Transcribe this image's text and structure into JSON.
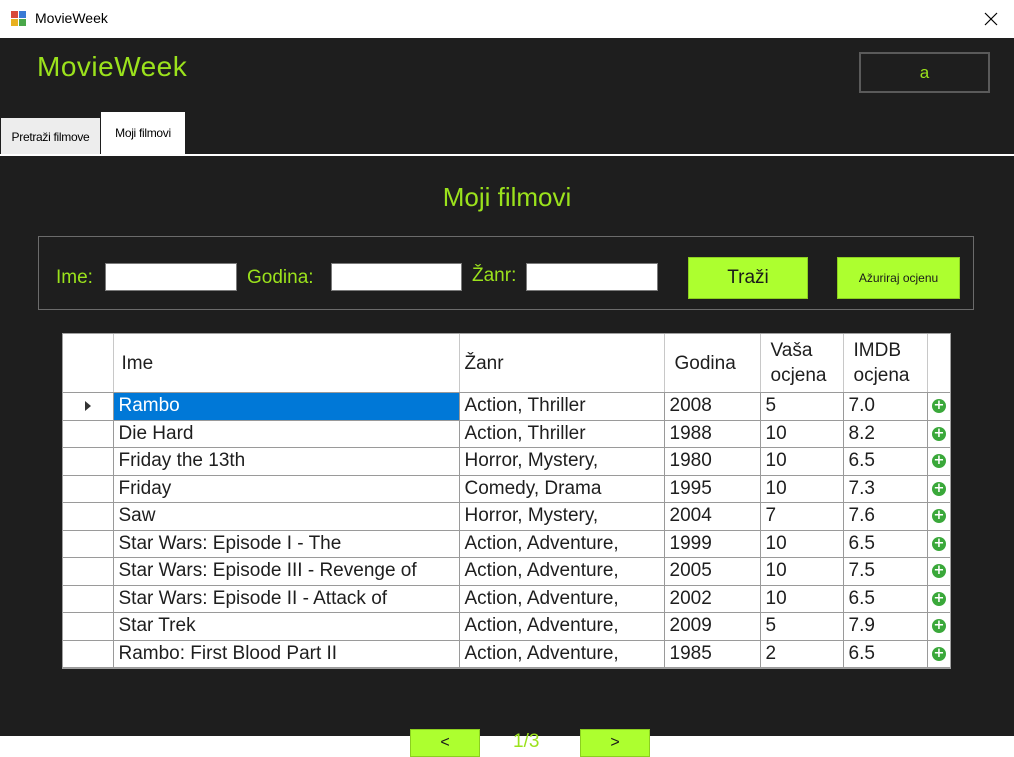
{
  "window": {
    "title": "MovieWeek",
    "close_glyph": "✕"
  },
  "header": {
    "brand": "MovieWeek",
    "user": "a"
  },
  "tabs": [
    {
      "label": "Pretraži filmove"
    },
    {
      "label": "Moji filmovi"
    }
  ],
  "page": {
    "heading": "Moji filmovi"
  },
  "filters": {
    "name_label": "Ime:",
    "year_label": "Godina:",
    "genre_label": "Žanr:",
    "name_value": "",
    "year_value": "",
    "genre_value": "",
    "search_button": "Traži",
    "update_rating_button": "Ažuriraj ocjenu"
  },
  "grid": {
    "columns": [
      "Ime",
      "Žanr",
      "Godina",
      "Vaša ocjena",
      "IMDB ocjena"
    ],
    "rows": [
      {
        "name": "Rambo",
        "genre": "Action, Thriller",
        "year": "2008",
        "rating": "5",
        "imdb": "7.0"
      },
      {
        "name": "Die Hard",
        "genre": "Action, Thriller",
        "year": "1988",
        "rating": "10",
        "imdb": "8.2"
      },
      {
        "name": "Friday the 13th",
        "genre": "Horror, Mystery,",
        "year": "1980",
        "rating": "10",
        "imdb": "6.5"
      },
      {
        "name": "Friday",
        "genre": "Comedy, Drama",
        "year": "1995",
        "rating": "10",
        "imdb": "7.3"
      },
      {
        "name": "Saw",
        "genre": "Horror, Mystery,",
        "year": "2004",
        "rating": "7",
        "imdb": "7.6"
      },
      {
        "name": "Star Wars: Episode I - The",
        "genre": "Action, Adventure,",
        "year": "1999",
        "rating": "10",
        "imdb": "6.5"
      },
      {
        "name": "Star Wars: Episode III - Revenge of",
        "genre": "Action, Adventure,",
        "year": "2005",
        "rating": "10",
        "imdb": "7.5"
      },
      {
        "name": "Star Wars: Episode II - Attack of",
        "genre": "Action, Adventure,",
        "year": "2002",
        "rating": "10",
        "imdb": "6.5"
      },
      {
        "name": "Star Trek",
        "genre": "Action, Adventure,",
        "year": "2009",
        "rating": "5",
        "imdb": "7.9"
      },
      {
        "name": "Rambo: First Blood Part II",
        "genre": "Action, Adventure,",
        "year": "1985",
        "rating": "2",
        "imdb": "6.5"
      }
    ],
    "selected_row": 0,
    "add_icon": "add-circle-icon"
  },
  "pager": {
    "prev": "<",
    "next": ">",
    "info": "1/3"
  },
  "colors": {
    "accent": "#9be21c",
    "button": "#adff2f",
    "background": "#1e1e1e",
    "selection": "#0078d7"
  }
}
